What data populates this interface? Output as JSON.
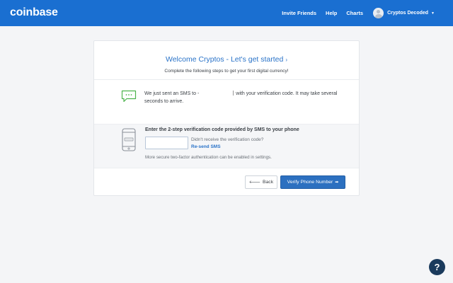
{
  "nav": {
    "logo": "coinbase",
    "links": [
      "Invite Friends",
      "Help",
      "Charts"
    ],
    "user_name": "Cryptos Decoded",
    "caret": "▼",
    "bg_color": "#1a6fd1"
  },
  "card": {
    "title": "Welcome Cryptos - Let's get started",
    "title_chevron": "›",
    "subtitle": "Complete the following steps to get your first digital currency!",
    "sms": {
      "icon": "chat-bubble-icon",
      "text_before": "We just sent an SMS to -",
      "text_after": "with your verification code. It may take several seconds to arrive."
    },
    "verify": {
      "icon": "phone-icon",
      "title": "Enter the 2-step verification code provided by SMS to your phone",
      "input_value": "",
      "input_placeholder": "",
      "didnt_receive": "Didn't receive the verification code?",
      "resend": "Re-send SMS",
      "secure_note": "More secure two-factor authentication can be enabled in settings."
    },
    "buttons": {
      "back_arrow": "🡐",
      "back": "Back",
      "verify": "Verify Phone Number",
      "verify_arrow": "➡"
    }
  },
  "help": {
    "icon": "help-question-icon",
    "glyph": "?"
  }
}
